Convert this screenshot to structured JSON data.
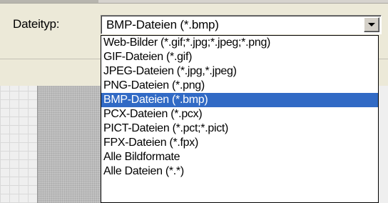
{
  "dialog": {
    "file_type_label": "Dateityp:",
    "file_type_value": "BMP-Dateien (*.bmp)"
  },
  "dropdown": {
    "selected_index": 4,
    "options": [
      "Web-Bilder (*.gif;*.jpg;*.jpeg;*.png)",
      "GIF-Dateien (*.gif)",
      "JPEG-Dateien (*.jpg,*.jpeg)",
      "PNG-Dateien (*.png)",
      "BMP-Dateien (*.bmp)",
      "PCX-Dateien (*.pcx)",
      "PICT-Dateien (*.pct;*.pict)",
      "FPX-Dateien (*.fpx)",
      "Alle Bildformate",
      "Alle Dateien (*.*)"
    ]
  },
  "colors": {
    "selection_highlight": "#316ac5",
    "dialog_background": "#ece9d8"
  },
  "icons": {
    "combo_button": "chevron-down-icon"
  }
}
